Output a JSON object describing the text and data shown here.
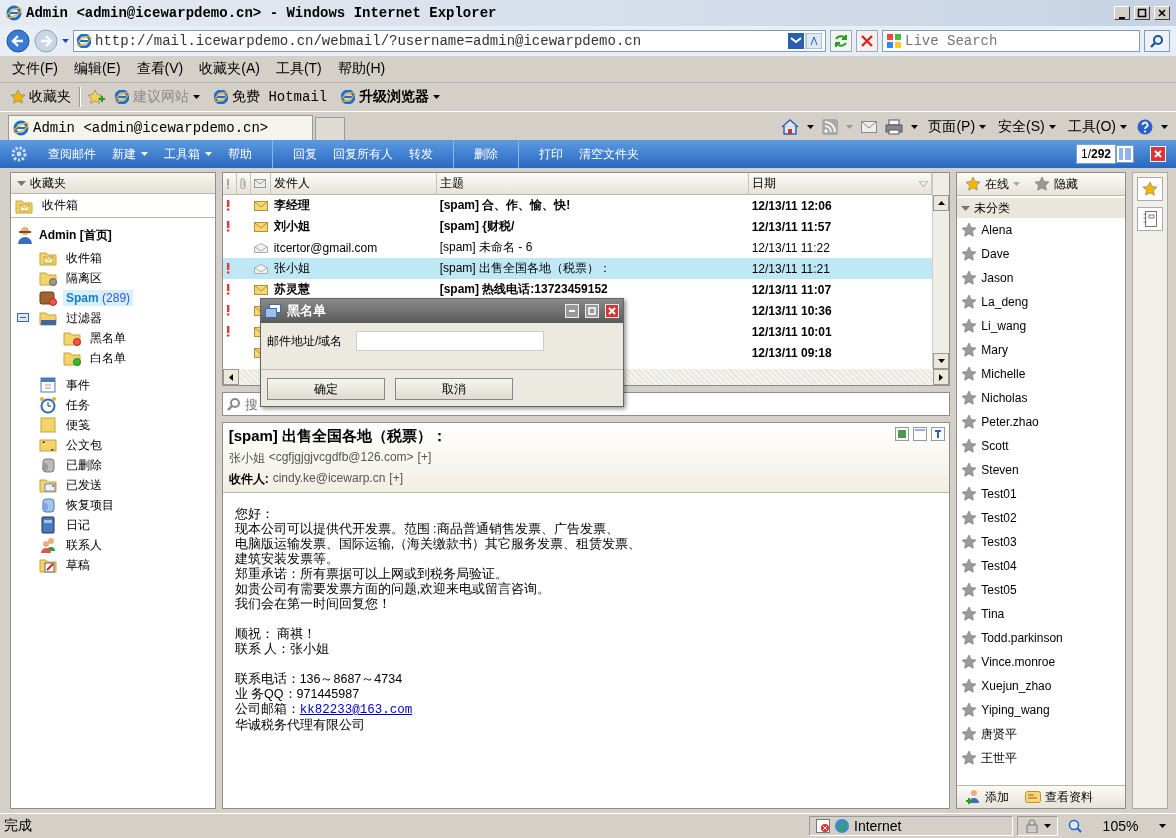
{
  "window": {
    "title": "Admin <admin@icewarpdemo.cn> - Windows Internet Explorer"
  },
  "address_bar": {
    "url": "http://mail.icewarpdemo.cn/webmail/?username=admin@icewarpdemo.cn",
    "search_placeholder": "Live Search"
  },
  "menu": [
    "文件(F)",
    "编辑(E)",
    "查看(V)",
    "收藏夹(A)",
    "工具(T)",
    "帮助(H)"
  ],
  "favorites_bar": {
    "label": "收藏夹",
    "links": [
      {
        "label": "建议网站",
        "menu": true,
        "disabled": true,
        "bold": false
      },
      {
        "label": "免费 Hotmail",
        "menu": false,
        "disabled": false,
        "bold": false
      },
      {
        "label": "升级浏览器",
        "menu": true,
        "disabled": false,
        "bold": true
      }
    ]
  },
  "tabs": [
    {
      "label": "Admin <admin@icewarpdemo.cn>",
      "selected": true
    }
  ],
  "command_bar": [
    "页面(P)",
    "安全(S)",
    "工具(O)"
  ],
  "toolbar": {
    "groups": [
      [
        {
          "label": "查阅邮件",
          "menu": false
        },
        {
          "label": "新建",
          "menu": true
        },
        {
          "label": "工具箱",
          "menu": true
        },
        {
          "label": "帮助",
          "menu": false
        }
      ],
      [
        {
          "label": "回复",
          "menu": false
        },
        {
          "label": "回复所有人",
          "menu": false
        },
        {
          "label": "转发",
          "menu": false
        }
      ],
      [
        {
          "label": "删除",
          "menu": false
        }
      ],
      [
        {
          "label": "打印",
          "menu": false
        },
        {
          "label": "清空文件夹",
          "menu": false
        }
      ]
    ],
    "pager": "1/**292**"
  },
  "folders": {
    "header": "收藏夹",
    "favorites": [
      {
        "label": "收件箱",
        "kind": "inbox"
      }
    ],
    "account": "Admin [首页]",
    "items": [
      {
        "label": "收件箱",
        "kind": "inbox",
        "selected": false
      },
      {
        "label": "隔离区",
        "kind": "quarantine",
        "selected": false
      },
      {
        "label": "Spam",
        "count": "(289)",
        "kind": "spam",
        "selected": true
      },
      {
        "label": "过滤器",
        "kind": "filter",
        "selected": false,
        "expanded": true,
        "children": [
          {
            "label": "黑名单",
            "kind": "blacklist",
            "selected": false
          },
          {
            "label": "白名单",
            "kind": "whitelist",
            "selected": false
          }
        ]
      },
      {
        "label": "事件",
        "kind": "calendar",
        "selected": false
      },
      {
        "label": "任务",
        "kind": "tasks",
        "selected": false
      },
      {
        "label": "便笺",
        "kind": "notes",
        "selected": false
      },
      {
        "label": "公文包",
        "kind": "files",
        "selected": false
      },
      {
        "label": "已删除",
        "kind": "trash",
        "selected": false
      },
      {
        "label": "已发送",
        "kind": "sent",
        "selected": false
      },
      {
        "label": "恢复项目",
        "kind": "recovery",
        "selected": false
      },
      {
        "label": "日记",
        "kind": "journal",
        "selected": false
      },
      {
        "label": "联系人",
        "kind": "contacts",
        "selected": false
      },
      {
        "label": "草稿",
        "kind": "drafts",
        "selected": false
      }
    ]
  },
  "messages": {
    "columns": [
      "发件人",
      "主题",
      "日期"
    ],
    "rows": [
      {
        "flagged": true,
        "unread": true,
        "selected": false,
        "sender": "李经理",
        "subject": "[spam] 合、作、愉、快!",
        "date": "12/13/11 12:06"
      },
      {
        "flagged": true,
        "unread": true,
        "selected": false,
        "sender": "刘小姐",
        "subject": "[spam] {财税/",
        "date": "12/13/11 11:57"
      },
      {
        "flagged": false,
        "unread": false,
        "selected": false,
        "sender": "itcertor@gmail.com",
        "subject": "[spam] 未命名 - 6",
        "date": "12/13/11 11:22"
      },
      {
        "flagged": true,
        "unread": false,
        "selected": true,
        "sender": "张小姐",
        "subject": "[spam] 出售全国各地（税票）：",
        "date": "12/13/11 11:21"
      },
      {
        "flagged": true,
        "unread": true,
        "selected": false,
        "sender": "苏灵慧",
        "subject": "[spam] 热线电话:13723459152",
        "date": "12/13/11 11:07"
      },
      {
        "flagged": true,
        "unread": true,
        "selected": false,
        "date": "12/13/11 10:36"
      },
      {
        "flagged": true,
        "unread": true,
        "selected": false,
        "date": "12/13/11 10:01"
      },
      {
        "flagged": false,
        "unread": true,
        "selected": false,
        "date": "12/13/11 09:18"
      }
    ]
  },
  "search": {
    "placeholder": "搜"
  },
  "dialog": {
    "title": "黑名单",
    "field_label": "邮件地址/域名",
    "buttons": [
      "确定",
      "取消"
    ]
  },
  "preview": {
    "subject": "[spam] 出售全国各地（税票）：",
    "from_name": "张小姐",
    "from_address": "<cgfjgjgjvcgdfb@126.com>",
    "from_expand": "[+]",
    "to_label": "收件人:",
    "to": "cindy.ke@icewarp.cn",
    "to_expand": "[+]",
    "body": [
      [
        "您好：",
        "现本公司可以提供代开发票。范围 :商品普通销售发票、广告发票、",
        "电脑版运输发票、国际运输,（海关缴款书）其它服务发票、租赁发票、",
        "建筑安装发票等。",
        "郑重承诺：所有票据可以上网或到税务局验证。",
        "如贵公司有需要发票方面的问题,欢迎来电或留言咨询。",
        "我们会在第一时间回复您！"
      ],
      [
        "顺祝： 商祺！",
        "联系 人：张小姐"
      ],
      [
        "联系电话：136～8687～4734",
        "业 务QQ：971445987",
        {
          "text": "公司邮箱：",
          "link": "kk82233@163.com"
        },
        "华诚税务代理有限公司"
      ]
    ]
  },
  "contacts": {
    "status": "在线",
    "hide": "隐藏",
    "groups": [
      {
        "name": "未分类",
        "expanded": true,
        "contacts": [
          "Alena",
          "Dave",
          "Jason",
          "La_deng",
          "Li_wang",
          "Mary",
          "Michelle",
          "Nicholas",
          "Peter.zhao",
          "Scott",
          "Steven",
          "Test01",
          "Test02",
          "Test03",
          "Test04",
          "Test05",
          "Tina",
          "Todd.parkinson",
          "Vince.monroe",
          "Xuejun_zhao",
          "Yiping_wang",
          "唐贤平",
          "王世平"
        ]
      }
    ],
    "actions": [
      "添加",
      "查看资料"
    ]
  },
  "status_bar": {
    "text": "完成",
    "zone": "Internet",
    "zoom": "105%"
  }
}
